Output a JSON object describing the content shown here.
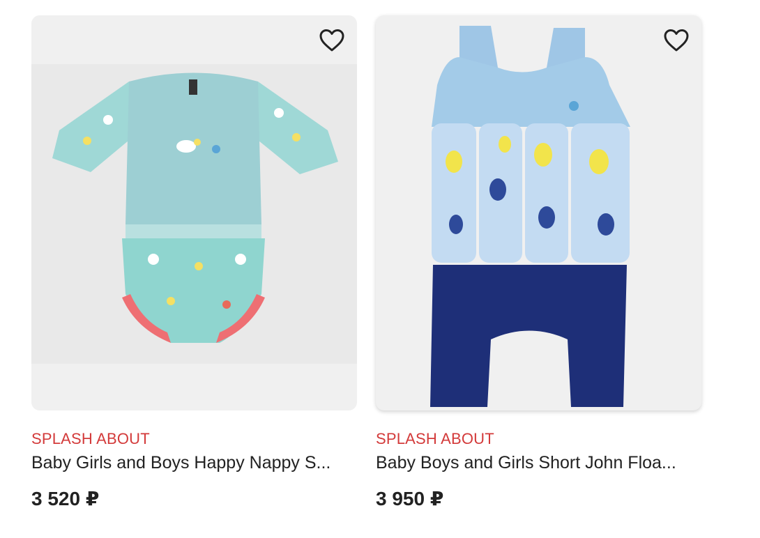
{
  "products": [
    {
      "brand": "SPLASH ABOUT",
      "title": "Baby Girls and Boys Happy Nappy S...",
      "price": "3 520 ₽",
      "favorite_icon": "heart-outline-icon",
      "image": "swim-nappy-suit-ducks-print"
    },
    {
      "brand": "SPLASH ABOUT",
      "title": "Baby Boys and Girls Short John Floa...",
      "price": "3 950 ₽",
      "favorite_icon": "heart-outline-icon",
      "image": "float-suit-bees-print"
    }
  ],
  "colors": {
    "brand_red": "#d33a3a",
    "text": "#222222",
    "card_bg": "#f0f0f0"
  }
}
